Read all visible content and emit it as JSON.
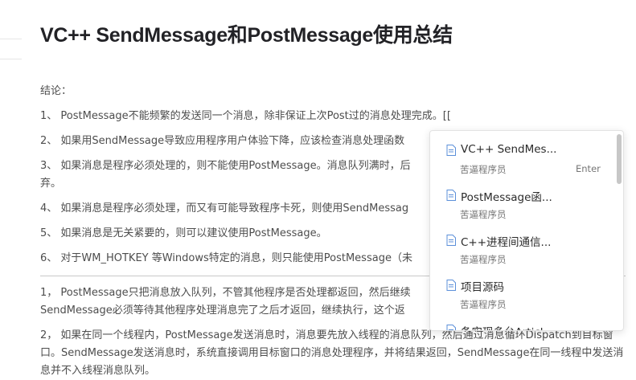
{
  "article": {
    "title": "VC++ SendMessage和PostMessage使用总结",
    "intro": "结论：",
    "points": [
      "1、  PostMessage不能频繁的发送同一个消息，除非保证上次Post过的消息处理完成。[[",
      "2、  如果用SendMessage导致应用程序用户体验下降，应该检查消息处理函数",
      "3、  如果消息是程序必须处理的，则不能使用PostMessage。消息队列满时，后",
      "弃。",
      "4、  如果消息是程序必须处理，而又有可能导致程序卡死，则使用SendMessag",
      "5、  如果消息是无关紧要的，则可以建议使用PostMessage。",
      "6、  对于WM_HOTKEY 等Windows特定的消息，则只能使用PostMessage（未"
    ],
    "para1_line1": "1， PostMessage只把消息放入队列，不管其他程序是否处理都返回，然后继续",
    "para1_line2": "SendMessage必须等待其他程序处理消息完了之后才返回，继续执行，这个返",
    "para2": "2， 如果在同一个线程内，PostMessage发送消息时，消息要先放入线程的消息队列，然后通过消息循环Dispatch到目标窗口。SendMessage发送消息时，系统直接调用目标窗口的消息处理程序，并将结果返回，SendMessage在同一线程中发送消息并不入线程消息队列。"
  },
  "popup": {
    "items": [
      {
        "title": "VC++ SendMes...",
        "subtitle": "苦逼程序员",
        "hint": "Enter",
        "icon": "document-icon"
      },
      {
        "title": "PostMessage函...",
        "subtitle": "苦逼程序员",
        "icon": "document-icon"
      },
      {
        "title": "C++进程间通信...",
        "subtitle": "苦逼程序员",
        "icon": "document-icon"
      },
      {
        "title": "项目源码",
        "subtitle": "苦逼程序员",
        "icon": "document-icon"
      },
      {
        "title": "条实现多台Articl",
        "subtitle": "",
        "icon": "document-icon"
      }
    ]
  },
  "colors": {
    "icon_blue": "#5b8fd9",
    "title": "#222226",
    "body_text": "#4d4d4d",
    "muted": "#757575"
  }
}
